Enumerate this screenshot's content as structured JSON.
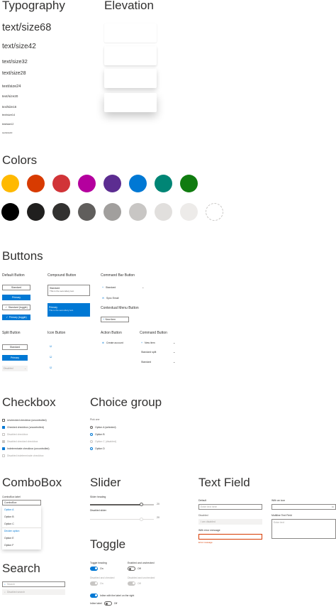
{
  "typography": {
    "heading": "Typography",
    "items": [
      {
        "label": "text/size68",
        "size": 14.5
      },
      {
        "label": "text/size42",
        "size": 10
      },
      {
        "label": "text/size32",
        "size": 7.5
      },
      {
        "label": "text/size28",
        "size": 7
      },
      {
        "label": "text/size24",
        "size": 5.5
      },
      {
        "label": "text/size20",
        "size": 4.7
      },
      {
        "label": "text/size16",
        "size": 4.2
      },
      {
        "label": "text/size14",
        "size": 3.8
      },
      {
        "label": "text/size12",
        "size": 3.4
      },
      {
        "label": "text/size10",
        "size": 3
      }
    ]
  },
  "elevation": {
    "heading": "Elevation",
    "cards": [
      {
        "shadow": "0 0.5px 1.5px rgba(0,0,0,0.12)"
      },
      {
        "shadow": "0 1.5px 3px rgba(0,0,0,0.14)"
      },
      {
        "shadow": "0 3px 7px rgba(0,0,0,0.18)"
      },
      {
        "shadow": "0 6px 12px rgba(0,0,0,0.22)"
      }
    ]
  },
  "colors": {
    "heading": "Colors",
    "row1": [
      "#ffb900",
      "#d83b01",
      "#d13438",
      "#b4009e",
      "#5c2d91",
      "#0078d4",
      "#008575",
      "#107c10"
    ],
    "row2": [
      "#000000",
      "#201f1e",
      "#323130",
      "#605e5c",
      "#a19f9d",
      "#c8c6c4",
      "#e1dfdd",
      "#edebe9",
      "#ffffff"
    ]
  },
  "buttons": {
    "heading": "Buttons",
    "default": {
      "title": "Default Button",
      "standard": "Standard",
      "primary": "Primary",
      "toggle_standard": "Standard (toggle)",
      "toggle_primary": "Primary (toggle)"
    },
    "compound": {
      "title": "Compound Button",
      "standard_label": "Standard",
      "standard_desc": "This is the secondary text.",
      "primary_label": "Primary",
      "primary_desc": "This is the secondary text."
    },
    "command_bar": {
      "title": "Command Bar Button",
      "item1": "Standard",
      "item2": "Sync Email"
    },
    "contextual": {
      "title": "Contextual Menu Button",
      "label": "New item"
    },
    "split": {
      "title": "Split Button",
      "standard": "Standard",
      "primary": "Primary",
      "disabled": "Disabled"
    },
    "icon": {
      "title": "Icon Button"
    },
    "action": {
      "title": "Action Button",
      "label": "Create account"
    },
    "command": {
      "title": "Command Button",
      "item1": "New item",
      "item2": "Standard split",
      "item3": "Standard"
    }
  },
  "checkbox": {
    "heading": "Checkbox",
    "items": [
      {
        "label": "Unchecked checkbox (uncontrolled)",
        "state": "off"
      },
      {
        "label": "Checked checkbox (uncontrolled)",
        "state": "on"
      },
      {
        "label": "Disabled checkbox",
        "state": "dis"
      },
      {
        "label": "Disabled checked checkbox",
        "state": "dis-on"
      },
      {
        "label": "Indeterminate checkbox (uncontrolled)",
        "state": "on"
      },
      {
        "label": "Disabled indeterminate checkbox",
        "state": "dis"
      }
    ]
  },
  "choice_group": {
    "heading": "Choice group",
    "label": "Pick one",
    "items": [
      {
        "label": "Option A (selected)",
        "state": "off"
      },
      {
        "label": "Option B",
        "state": "on"
      },
      {
        "label": "Option C (disabled)",
        "state": "dis"
      },
      {
        "label": "Option D",
        "state": "on"
      }
    ]
  },
  "combobox": {
    "heading": "ComboBox",
    "label": "ComboBox label",
    "value": "ComboBox",
    "options": [
      "Option A",
      "Option B",
      "Option C",
      "Divider option",
      "Option E",
      "Option F"
    ]
  },
  "slider": {
    "heading": "Slider",
    "items": [
      {
        "label": "Slider heading",
        "value": "20",
        "fraction": 0.8
      },
      {
        "label": "Disabled slider",
        "value": "20",
        "fraction": 0.8
      }
    ]
  },
  "toggle": {
    "heading": "Toggle",
    "items": [
      {
        "label": "Toggle heading",
        "state_text": "On",
        "state": "on"
      },
      {
        "label": "Enabled and unchecked",
        "state_text": "Off",
        "state": "off"
      },
      {
        "label": "Disabled and checked",
        "state_text": "On",
        "state": "dis"
      },
      {
        "label": "Disabled and unchecked",
        "state_text": "Off",
        "state": "dis"
      },
      {
        "label": "",
        "state_text": "Inline with the label on the right",
        "state": "on"
      },
      {
        "label": "Inline label",
        "state_text": "Off",
        "state": "off"
      }
    ]
  },
  "search": {
    "heading": "Search",
    "placeholder": "Search",
    "disabled_placeholder": "Disabled search"
  },
  "text_field": {
    "heading": "Text Field",
    "fields": [
      {
        "label": "Default",
        "placeholder": "Enter text here"
      },
      {
        "label": "With an icon",
        "placeholder": ""
      },
      {
        "label": "Disabled",
        "placeholder": "I am disabled"
      },
      {
        "label": "Multiline Text Field",
        "placeholder": "Enter text"
      },
      {
        "label": "With error message",
        "placeholder": ""
      },
      {
        "error": "Error message"
      }
    ]
  }
}
